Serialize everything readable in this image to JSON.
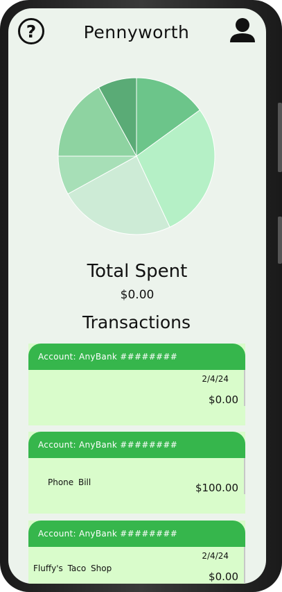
{
  "app": {
    "title": "Pennyworth"
  },
  "icons": {
    "help": "help-question-icon",
    "profile": "profile-person-icon"
  },
  "colors": {
    "accent_green": "#36b64c",
    "card_bg": "#d9fccb",
    "screen_bg": "#ecf3ec"
  },
  "chart_data": {
    "type": "pie",
    "title": "",
    "slices": [
      {
        "value": 15,
        "color": "#6cc58a"
      },
      {
        "value": 28,
        "color": "#b5f0c6"
      },
      {
        "value": 24,
        "color": "#cdebd6"
      },
      {
        "value": 8,
        "color": "#a7dfb7"
      },
      {
        "value": 17,
        "color": "#8ed3a1"
      },
      {
        "value": 8,
        "color": "#5aab76"
      }
    ]
  },
  "summary": {
    "total_label": "Total Spent",
    "total_value": "$0.00"
  },
  "transactions_heading": "Transactions",
  "transactions": [
    {
      "account": "Account: AnyBank ########",
      "date": "2/4/24",
      "description": "",
      "amount": "$0.00"
    },
    {
      "account": "Account: AnyBank ########",
      "date": "",
      "description": "Phone Bill",
      "amount": "$100.00"
    },
    {
      "account": "Account: AnyBank ########",
      "date": "2/4/24",
      "description": "Fluffy's Taco Shop",
      "amount": "$0.00"
    }
  ]
}
